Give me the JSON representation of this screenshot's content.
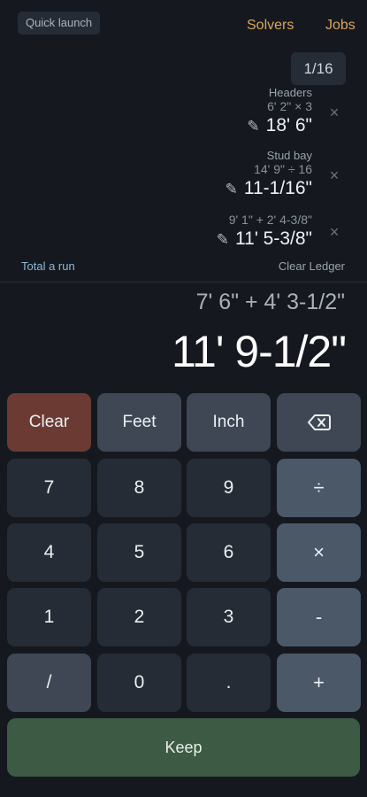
{
  "header": {
    "quick_launch_label": "Quick launch",
    "solvers_label": "Solvers",
    "jobs_label": "Jobs",
    "page_indicator": "1/16"
  },
  "ledger": {
    "entries": [
      {
        "label": "Headers",
        "expression": "6' 2\" × 3",
        "result": "18' 6\""
      },
      {
        "label": "Stud bay",
        "expression": "14' 9\" ÷ 16",
        "result": "11-1/16\""
      },
      {
        "label": "",
        "expression": "9' 1\" + 2' 4-3/8\"",
        "result": "11' 5-3/8\""
      }
    ],
    "edit_icon": "✎",
    "remove_icon": "×",
    "total_run_label": "Total a run",
    "clear_ledger_label": "Clear Ledger"
  },
  "display": {
    "expression": "7' 6\" + 4' 3-1/2\"",
    "result": "11' 9-1/2\""
  },
  "keypad": {
    "clear": "Clear",
    "feet": "Feet",
    "inch": "Inch",
    "seven": "7",
    "eight": "8",
    "nine": "9",
    "divide": "÷",
    "four": "4",
    "five": "5",
    "six": "6",
    "multiply": "×",
    "one": "1",
    "two": "2",
    "three": "3",
    "minus": "-",
    "slash": "/",
    "zero": "0",
    "dot": ".",
    "plus": "+",
    "keep": "Keep"
  }
}
